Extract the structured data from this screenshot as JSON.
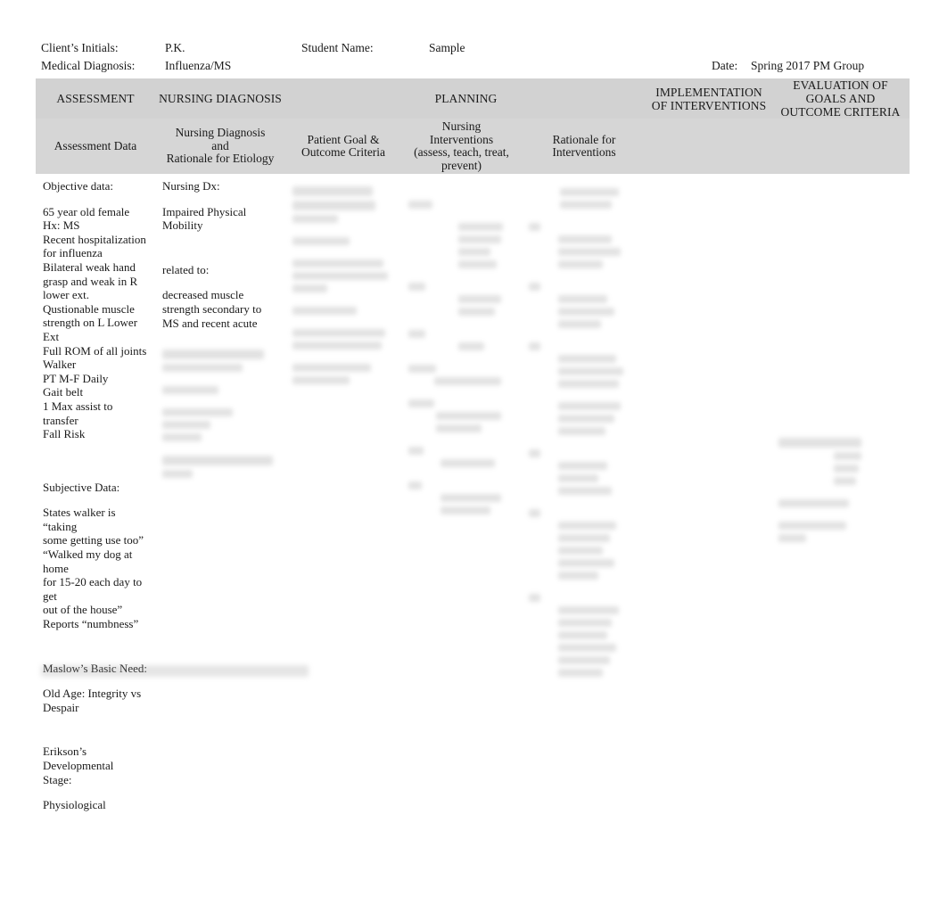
{
  "header": {
    "fields": [
      {
        "label": "Client’s Initials:",
        "value": "P.K."
      },
      {
        "label": "Student Name:",
        "value": "Sample"
      },
      {
        "label": "Medical Diagnosis:",
        "value": "Influenza/MS"
      },
      {
        "label": "Date:",
        "value": "Spring 2017 PM Group"
      }
    ]
  },
  "table": {
    "main_headers": [
      "ASSESSMENT",
      "NURSING DIAGNOSIS",
      "PLANNING",
      "IMPLEMENTATION OF INTERVENTIONS",
      "EVALUATION OF GOALS AND OUTCOME CRITERIA"
    ],
    "main_headers_multiline": {
      "implementation_line1": "IMPLEMENTATION",
      "implementation_line2": "OF INTERVENTIONS",
      "evaluation_line1": "EVALUATION OF",
      "evaluation_line2": "GOALS AND",
      "evaluation_line3": "OUTCOME CRITERIA"
    },
    "sub_headers": {
      "assessment": "Assessment Data",
      "diagnosis_line1": "Nursing Diagnosis",
      "diagnosis_line2": "and",
      "diagnosis_line3": "Rationale for Etiology",
      "goal_line1": "Patient Goal &",
      "goal_line2": "Outcome Criteria",
      "interventions_line1": "Nursing",
      "interventions_line2": "Interventions",
      "interventions_line3": "(assess, teach, treat,",
      "interventions_line4": "prevent)",
      "rationale_line1": "Rationale for",
      "rationale_line2": "Interventions",
      "implementation": "",
      "evaluation": ""
    },
    "body": {
      "assessment": {
        "objective_label": "Objective data:",
        "objective_items": [
          "65 year old female",
          "Hx: MS",
          "Recent hospitalization",
          "for influenza",
          "Bilateral weak hand",
          "grasp and weak in R",
          "lower ext.",
          "Qustionable muscle",
          "strength on L Lower Ext",
          "Full ROM of all joints",
          "Walker",
          "PT M-F Daily",
          "Gait belt",
          "1 Max assist to transfer",
          "Fall Risk"
        ],
        "subjective_label": "Subjective Data:",
        "subjective_items": [
          "States walker is “taking",
          "some getting use too”",
          "“Walked my dog at home",
          "for 15-20 each day to get",
          "out of the house”",
          "Reports “numbness”"
        ],
        "maslow_label": "Maslow’s Basic Need:",
        "maslow_items": [
          "Old Age: Integrity vs",
          "Despair"
        ],
        "erikson_label_line1": "Erikson’s Developmental",
        "erikson_label_line2": "Stage:",
        "erikson_items": [
          "Physiological"
        ]
      },
      "diagnosis": {
        "label": "Nursing Dx:",
        "dx_line1": "Impaired Physical",
        "dx_line2": "Mobility",
        "related_to": "related to:",
        "etiology_line1": "decreased muscle",
        "etiology_line2": "strength secondary to",
        "etiology_line3": "MS and recent acute"
      }
    }
  }
}
